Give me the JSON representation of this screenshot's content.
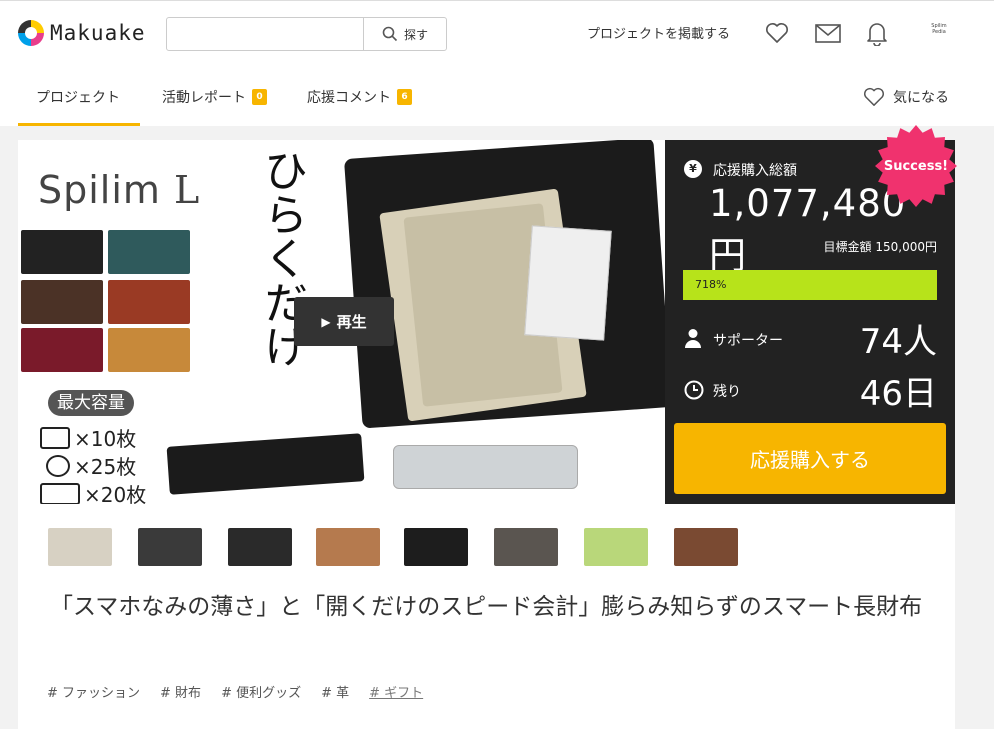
{
  "header": {
    "logo_text": "Makuake",
    "search": {
      "placeholder": "",
      "button_label": "探す"
    },
    "post_project_label": "プロジェクトを掲載する",
    "avatar_text": "Spilim Pedia"
  },
  "tabs": [
    {
      "label": "プロジェクト",
      "active": true
    },
    {
      "label": "活動レポート",
      "badge": "0"
    },
    {
      "label": "応援コメント",
      "badge": "6"
    }
  ],
  "favorite_label": "気になる",
  "hero": {
    "brand": "Spilim",
    "brand_suffix": "L",
    "vertical_text": "ひらくだけ",
    "capacity_label": "最大容量",
    "capacity_rows": [
      "×10枚",
      "×25枚",
      "×20枚"
    ],
    "play_label": "再生",
    "swatch_colors": [
      "#222222",
      "#2f5a5c",
      "#4b3226",
      "#9a3a24",
      "#7a1a2a",
      "#c7893a"
    ]
  },
  "funding": {
    "total_label": "応援購入総額",
    "amount": "1,077,480円",
    "goal": "目標金額 150,000円",
    "progress_text": "718%",
    "progress_percent": 718,
    "supporters_label": "サポーター",
    "supporters_value": "74人",
    "remaining_label": "残り",
    "remaining_value": "46日",
    "buy_label": "応援購入する",
    "status_badge": "Success!",
    "accent": "#f7b500",
    "progress_color": "#b7e31a",
    "badge_color": "#f0326e"
  },
  "thumb_colors": [
    "#d7d1c3",
    "#3a3a3a",
    "#2a2a2a",
    "#b57a4e",
    "#1d1d1d",
    "#5a5550",
    "#b9d77a",
    "#7a4a32"
  ],
  "title": "「スマホなみの薄さ」と「開くだけのスピード会計」膨らみ知らずのスマート長財布",
  "tags": [
    {
      "label": "# ファッション"
    },
    {
      "label": "# 財布"
    },
    {
      "label": "# 便利グッズ"
    },
    {
      "label": "# 革"
    },
    {
      "label": "# ギフト",
      "link": true
    }
  ]
}
